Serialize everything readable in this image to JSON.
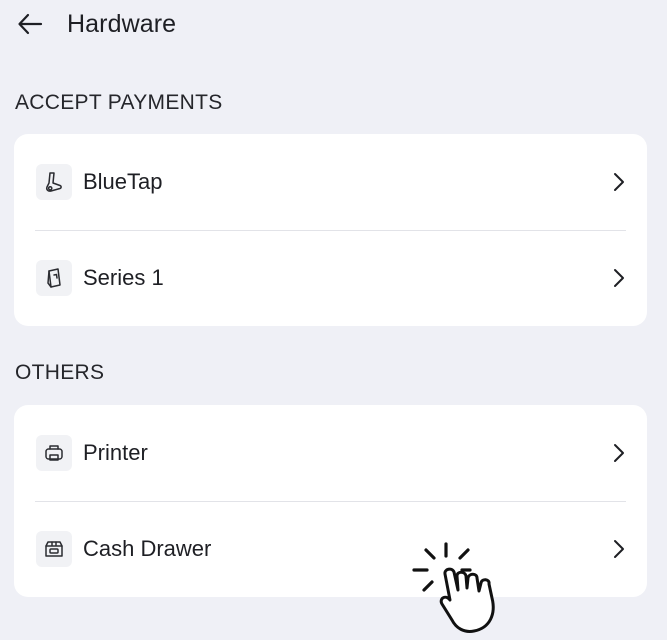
{
  "header": {
    "title": "Hardware",
    "back_icon": "arrow-left-icon"
  },
  "sections": [
    {
      "heading": "ACCEPT PAYMENTS",
      "items": [
        {
          "label": "BlueTap",
          "icon": "card-reader-icon"
        },
        {
          "label": "Series 1",
          "icon": "terminal-icon"
        }
      ]
    },
    {
      "heading": "OTHERS",
      "items": [
        {
          "label": "Printer",
          "icon": "printer-icon"
        },
        {
          "label": "Cash Drawer",
          "icon": "cash-drawer-icon"
        }
      ]
    }
  ],
  "colors": {
    "background": "#eff0f6",
    "card": "#ffffff",
    "text": "#1e1f24",
    "divider": "#e2e3e8"
  },
  "overlay": {
    "icon": "tap-hand-cursor-icon"
  }
}
